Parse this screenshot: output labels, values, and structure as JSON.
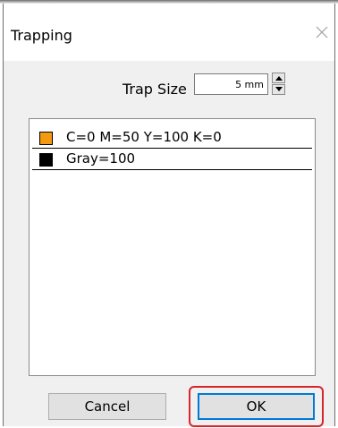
{
  "window": {
    "title": "Trapping",
    "close_label": "×"
  },
  "trap_size": {
    "label": "Trap Size",
    "value": "5 mm"
  },
  "color_list": [
    {
      "label": "C=0 M=50 Y=100 K=0",
      "swatch_color": "#f39a12"
    },
    {
      "label": "Gray=100",
      "swatch_color": "#000000"
    }
  ],
  "buttons": {
    "cancel_label": "Cancel",
    "ok_label": "OK"
  },
  "colors": {
    "highlight": "#d9252a",
    "focus_border": "#0078d7"
  }
}
